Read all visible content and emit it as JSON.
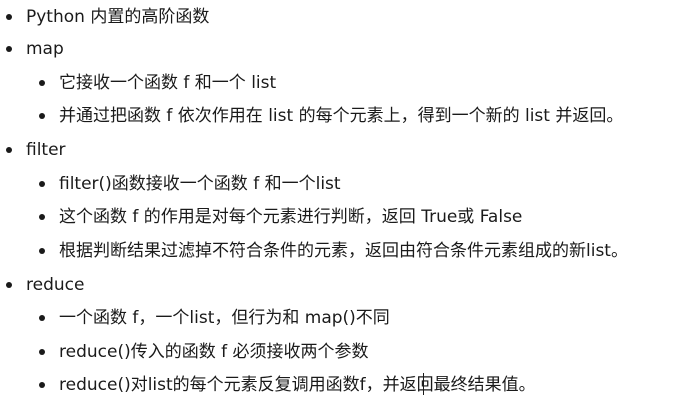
{
  "items": [
    {
      "level": 1,
      "text": "Python 内置的高阶函数"
    },
    {
      "level": 1,
      "text": "map"
    },
    {
      "level": 2,
      "text": "它接收一个函数 f 和一个 list"
    },
    {
      "level": 2,
      "text": "并通过把函数 f 依次作用在 list 的每个元素上，得到一个新的 list 并返回。"
    },
    {
      "level": 1,
      "text": "filter"
    },
    {
      "level": 2,
      "text": "filter()函数接收一个函数 f 和一个list"
    },
    {
      "level": 2,
      "text": "这个函数 f 的作用是对每个元素进行判断，返回 True或 False"
    },
    {
      "level": 2,
      "text": "根据判断结果过滤掉不符合条件的元素，返回由符合条件元素组成的新list。"
    },
    {
      "level": 1,
      "text": "reduce"
    },
    {
      "level": 2,
      "text": "一个函数 f，一个list，但行为和 map()不同"
    },
    {
      "level": 2,
      "text": "reduce()传入的函数 f 必须接收两个参数"
    },
    {
      "level": 2,
      "text": "reduce()对list的每个元素反复调用函数f，并返回最终结果值。"
    }
  ]
}
